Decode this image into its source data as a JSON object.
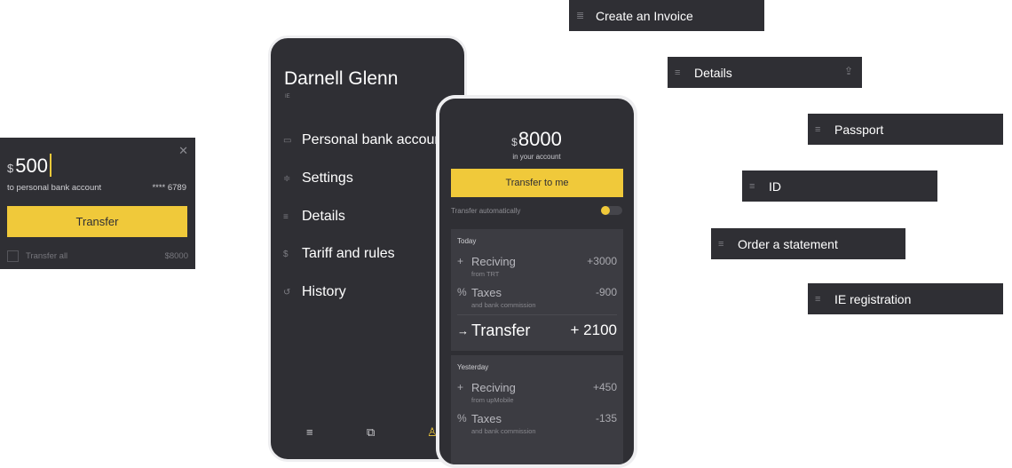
{
  "transfer_card": {
    "currency": "$",
    "amount": "500",
    "close_icon": "close-icon",
    "destination": "to personal bank account",
    "card_number": "**** 6789",
    "button_label": "Transfer",
    "checkbox_label": "Transfer all",
    "total": "$8000"
  },
  "menu_phone": {
    "name": "Darnell Glenn",
    "role": "IE",
    "items": [
      {
        "icon": "card-icon",
        "glyph": "▭",
        "label": "Personal bank account"
      },
      {
        "icon": "sliders-icon",
        "glyph": "≑",
        "label": "Settings"
      },
      {
        "icon": "lines-icon",
        "glyph": "≡",
        "label": "Details"
      },
      {
        "icon": "dollar-icon",
        "glyph": "$",
        "label": "Tariff and rules"
      },
      {
        "icon": "history-icon",
        "glyph": "↺",
        "label": "History"
      }
    ],
    "tabbar": [
      {
        "icon": "list-icon",
        "glyph": "≡"
      },
      {
        "icon": "copy-icon",
        "glyph": "⧉"
      },
      {
        "icon": "user-icon",
        "glyph": "♙"
      }
    ]
  },
  "account_phone": {
    "currency": "$",
    "balance": "8000",
    "balance_caption": "in your account",
    "button_label": "Transfer to me",
    "auto_label": "Transfer automatically",
    "auto_enabled": true,
    "days": [
      {
        "label": "Today",
        "transactions": [
          {
            "symbol": "+",
            "title": "Reciving",
            "subtitle": "from TRT",
            "value": "+3000"
          },
          {
            "symbol": "%",
            "title": "Taxes",
            "subtitle": "and bank commission",
            "value": "-900"
          }
        ],
        "total": {
          "symbol": "→",
          "title": "Transfer",
          "value": "+ 2100"
        }
      },
      {
        "label": "Yesterday",
        "transactions": [
          {
            "symbol": "+",
            "title": "Reciving",
            "subtitle": "from upMobile",
            "value": "+450"
          },
          {
            "symbol": "%",
            "title": "Taxes",
            "subtitle": "and bank commission",
            "value": "-135"
          }
        ]
      }
    ]
  },
  "right_items": [
    {
      "icon": "invoice-icon",
      "glyph": "≣",
      "label": "Create an Invoice"
    },
    {
      "icon": "lines-icon",
      "glyph": "≡",
      "label": "Details",
      "extra_icon": "share-icon"
    },
    {
      "icon": "lines-icon",
      "glyph": "≡",
      "label": "Passport"
    },
    {
      "icon": "lines-icon",
      "glyph": "≡",
      "label": "ID"
    },
    {
      "icon": "lines-icon",
      "glyph": "≡",
      "label": "Order a statement"
    },
    {
      "icon": "lines-icon",
      "glyph": "≡",
      "label": "IE registration"
    }
  ],
  "colors": {
    "accent": "#f0c93a",
    "panel": "#2f2f34",
    "panel_light": "#3c3c42"
  }
}
